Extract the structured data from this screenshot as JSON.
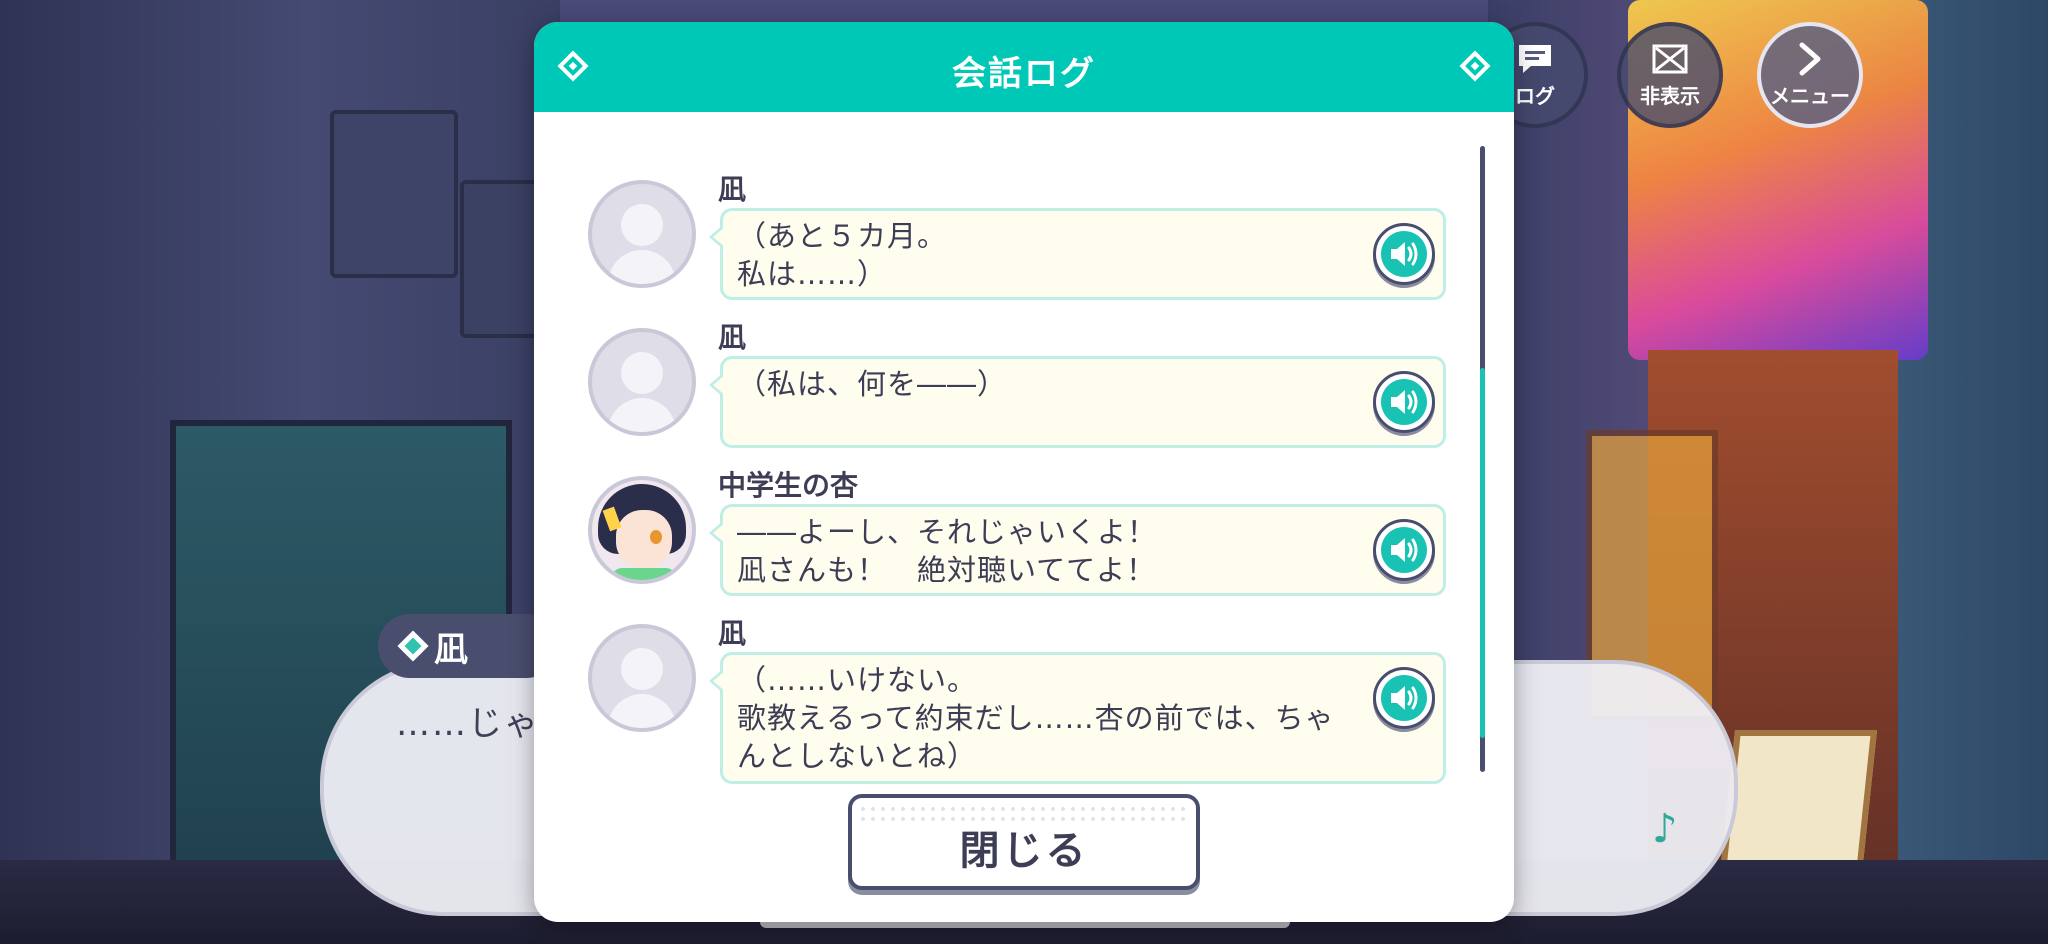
{
  "hud": {
    "log_label": "ログ",
    "hide_label": "非表示",
    "menu_label": "メニュー"
  },
  "story": {
    "speaker": "凪",
    "text": "……じゃ"
  },
  "log": {
    "title": "会話ログ",
    "entries": [
      {
        "speaker": "凪",
        "text": "（あと５カ月。\n私は……）",
        "avatar": "placeholder"
      },
      {
        "speaker": "凪",
        "text": "（私は、何を――）",
        "avatar": "placeholder"
      },
      {
        "speaker": "中学生の杏",
        "text": "――よーし、それじゃいくよ！\n凪さんも！　絶対聴いててよ！",
        "avatar": "character-portrait"
      },
      {
        "speaker": "凪",
        "text": "（……いけない。\n歌教えるって約束だし……杏の前では、ちゃんとしないとね）",
        "avatar": "placeholder"
      }
    ],
    "close_label": "閉じる"
  },
  "colors": {
    "accent": "#00c8b7",
    "bubble_bg": "#fffdee",
    "text": "#3d3d55"
  }
}
